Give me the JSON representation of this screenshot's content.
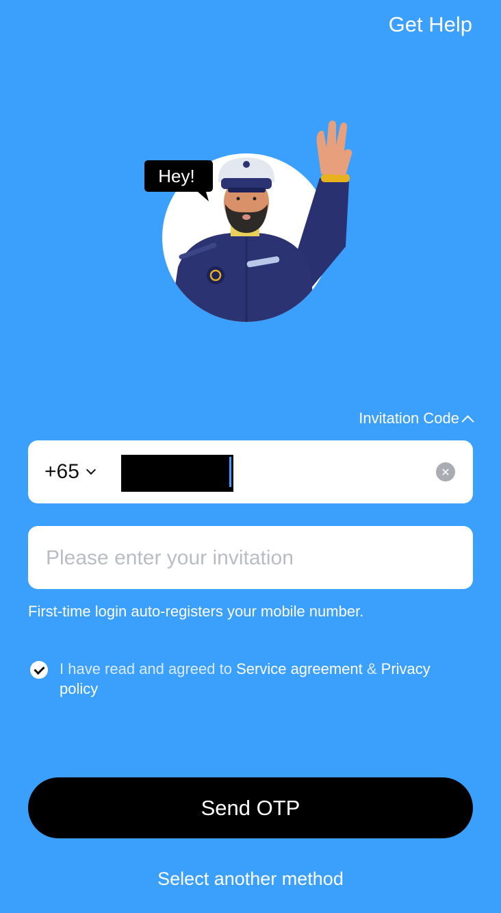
{
  "header": {
    "help_label": "Get Help"
  },
  "illustration": {
    "bubble_text": "Hey!",
    "icon": "captain-waving-illustration"
  },
  "invitation_toggle": {
    "label": "Invitation Code",
    "icon": "chevron-up-icon"
  },
  "phone": {
    "country_code": "+65",
    "value": "",
    "redacted": true,
    "clear_icon": "clear-icon"
  },
  "invitation": {
    "placeholder": "Please enter your invitation",
    "value": ""
  },
  "hint": "First-time login auto-registers your mobile number.",
  "agreement": {
    "checked": true,
    "prefix": "I have read and agreed to ",
    "service_link": "Service agreement",
    "connector": " & ",
    "privacy_link": "Privacy policy"
  },
  "actions": {
    "send_otp": "Send OTP",
    "alt_method": "Select another method"
  },
  "colors": {
    "background": "#3b9ffc",
    "button": "#000000",
    "field": "#ffffff"
  }
}
